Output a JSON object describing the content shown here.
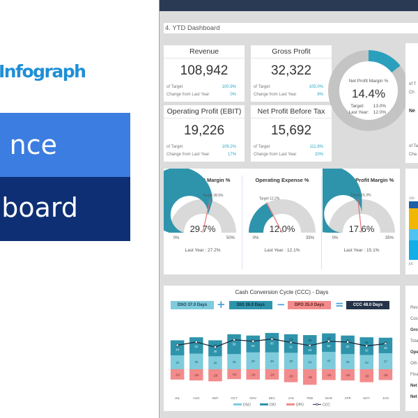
{
  "promo": {
    "brand": "Infograph",
    "banner_line1": "nce",
    "banner_line2": "board",
    "colors": {
      "brand": "#1e8fd6",
      "banner_top": "#3b7de0",
      "banner_bottom": "#0e2f74"
    }
  },
  "sheet": {
    "title": "4. YTD Dashboard"
  },
  "kpis": [
    {
      "title": "Revenue",
      "value": "108,942",
      "target_label": "of Target",
      "target": "100.9%",
      "change_label": "Change from Last Year",
      "change": "0%"
    },
    {
      "title": "Gross Profit",
      "value": "32,322",
      "target_label": "of Target",
      "target": "105.0%",
      "change_label": "Change from Last Year",
      "change": "9%"
    },
    {
      "title": "Operating Profit (EBIT)",
      "value": "19,226",
      "target_label": "of Target",
      "target": "109.2%",
      "change_label": "Change from Last Year",
      "change": "17%"
    },
    {
      "title": "Net Profit Before Tax",
      "value": "15,692",
      "target_label": "of Target",
      "target": "111.8%",
      "change_label": "Change from Last Year",
      "change": "20%"
    }
  ],
  "net_profit_margin": {
    "title": "Net Profit Margin %",
    "value": "14.4%",
    "value_pct": 14.4,
    "target_label": "Target:",
    "target": "13.0%",
    "last_year_label": "Last Year:",
    "last_year": "12.0%"
  },
  "gauges": [
    {
      "title": "Gross Profit Margin %",
      "value": "29.7%",
      "value_num": 29.7,
      "target_label": "Target 28.5%",
      "target_num": 28.5,
      "min": "0%",
      "max": "50%",
      "max_num": 50,
      "last_year": "Last Year : 27.2%"
    },
    {
      "title": "Operating Expense %",
      "value": "12.0%",
      "value_num": 12.0,
      "target_label": "Target 12.2%",
      "target_num": 12.2,
      "min": "0%",
      "max": "35%",
      "max_num": 35,
      "last_year": "Last Year : 12.1%"
    },
    {
      "title": "Operating Profit Margin %",
      "value": "17.6%",
      "value_num": 17.6,
      "target_label": "Target 16.3%",
      "target_num": 16.3,
      "min": "0%",
      "max": "35%",
      "max_num": 35,
      "last_year": "Last Year : 15.1%"
    }
  ],
  "ccc": {
    "title": "Cash Conversion Cycle (CCC) - Days",
    "dso": "DSO 37.0 Days",
    "plus": "+",
    "dio": "DIO 36.0 Days",
    "minus": "−",
    "dpo": "DPO 25.0 Days",
    "equals": "=",
    "ccc": "CCC 48.0 Days",
    "colors": {
      "dso": "#7ecbdc",
      "dio": "#2e94ab",
      "dpo": "#f28b8b",
      "ccc": "#25334a"
    }
  },
  "side": {
    "kpi_rows": [
      "of T",
      "Ch",
      "Ne",
      "of Ta",
      "Cha"
    ],
    "pl_rows": [
      {
        "label": "Rev",
        "bold": false
      },
      {
        "label": "Cos",
        "bold": false
      },
      {
        "label": "Gro",
        "bold": true
      },
      {
        "label": "Tota",
        "bold": false
      },
      {
        "label": "Ope",
        "bold": true
      },
      {
        "label": "Oth",
        "bold": false
      },
      {
        "label": "Fina",
        "bold": false
      },
      {
        "label": "Net",
        "bold": true
      },
      {
        "label": "Net",
        "bold": true
      }
    ],
    "bar_axis_top": "100",
    "bar_axis_bottom": "JUL"
  },
  "chart_data": {
    "type": "bar",
    "title": "Cash Conversion Cycle (CCC) - Days",
    "categories": [
      "JUL",
      "AUG",
      "SEP",
      "OCT",
      "NOV",
      "DEC",
      "JAN",
      "FEB",
      "MAR",
      "APR",
      "MAY",
      "JUN"
    ],
    "series": [
      {
        "name": "DSO",
        "values": [
          32,
          36,
          30,
          35,
          39,
          39,
          38,
          34,
          40,
          35,
          33,
          37
        ]
      },
      {
        "name": "DIO",
        "values": [
          35,
          38,
          37,
          46,
          39,
          45,
          43,
          45,
          43,
          43,
          41,
          36
        ]
      },
      {
        "name": "DPO",
        "values": [
          -24,
          -26,
          -28,
          -23,
          -24,
          -24,
          -30,
          -36,
          -25,
          -26,
          -30,
          -25
        ]
      },
      {
        "name": "CCC",
        "values": [
          44,
          52,
          39,
          58,
          54,
          60,
          51,
          43,
          54,
          52,
          42,
          48
        ]
      }
    ],
    "legend": [
      "DSO",
      "DIO",
      "DPO",
      "CCC"
    ],
    "legend_position": "bottom",
    "stacked": true,
    "xlabel": "",
    "ylabel": ""
  }
}
